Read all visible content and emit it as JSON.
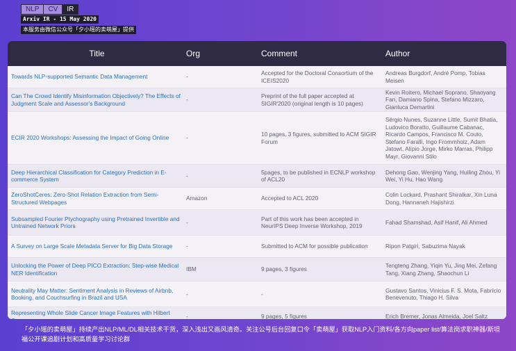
{
  "tabs": [
    {
      "label": "NLP",
      "active": false
    },
    {
      "label": "CV",
      "active": false
    },
    {
      "label": "IR",
      "active": true
    }
  ],
  "header": {
    "date_label": "Arxiv IR - 15 May 2020",
    "credit_label": "本服务由微信公众号「夕小瑶的卖萌屋」提供"
  },
  "table": {
    "columns": [
      "Title",
      "Org",
      "Comment",
      "Author"
    ],
    "rows": [
      {
        "title": "Towards NLP-supported Semantic Data Management",
        "org": "-",
        "comment": "Accepted for the Doctoral Consortium of the ICEIS2020",
        "author": "Andreas Burgdorf, André Pomp, Tobias Meisen"
      },
      {
        "title": "Can The Crowd Identify Misinformation Objectively? The Effects of Judgment Scale and Assessor's Background",
        "org": "-",
        "comment": "Preprint of the full paper accepted at SIGIR'2020 (original length is 10 pages)",
        "author": "Kevin Roitero, Michael Soprano, Shaoyang Fan, Damiano Spina, Stefano Mizzaro, Gianluca Demartini"
      },
      {
        "title": "ECIR 2020 Workshops: Assessing the Impact of Going Online",
        "org": "-",
        "comment": "10 pages, 3 figures, submitted to ACM SIGIR Forum",
        "author": "Sérgio Nunes, Suzanne Little, Sumit Bhatia, Ludovico Boratto, Guillaume Cabanac, Ricardo Campos, Francisco M. Couto, Stefano Faralli, Ingo Frommholz, Adam Jatowt, Alípio Jorge, Mirko Marras, Philipp Mayr, Giovanni Stilo"
      },
      {
        "title": "Deep Hierarchical Classification for Category Prediction in E-commerce System",
        "org": "-",
        "comment": "5pages, to be published in ECNLP workshop of ACL20",
        "author": "Dehong Gao, Wenjing Yang, Huiling Zhou, Yi Wei, Yi Hu, Hao Wang"
      },
      {
        "title": "ZeroShotCeres: Zero-Shot Relation Extraction from Semi-Structured Webpages",
        "org": "Amazon",
        "comment": "Accepted to ACL 2020",
        "author": "Colin Lockard, Prashant Shiralkar, Xin Luna Dong, Hannaneh Hajishirzi"
      },
      {
        "title": "Subsampled Fourier Ptychography using Pretrained Invertible and Untrained Network Priors",
        "org": "-",
        "comment": "Part of this work has been accepted in NeurIPS Deep Inverse Workshop, 2019",
        "author": "Fahad Shamshad, Asif Hanif, Ali Ahmed"
      },
      {
        "title": "A Survey on Large Scale Metadata Server for Big Data Storage",
        "org": "-",
        "comment": "Submitted to ACM for possible publication",
        "author": "Ripon Patgiri, Sabuzima Nayak"
      },
      {
        "title": "Unlocking the Power of Deep PICO Extraction: Step-wise Medical NER Identification",
        "org": "IBM",
        "comment": "9 pages, 3 figures",
        "author": "Tengteng Zhang, Yiqin Yu, Jing Mei, Zefang Tang, Xiang Zhang, Shaochun Li"
      },
      {
        "title": "Neutrality May Matter: Sentiment Analysis in Reviews of Airbnb, Booking, and Couchsurfing in Brazil and USA",
        "org": "-",
        "comment": "-",
        "author": "Gustavo Santos, Vinicius F. S. Mota, Fabrício Benevenuto, Thiago H. Silva"
      },
      {
        "title": "Representing Whole Slide Cancer Image Features with Hilbert Curves",
        "org": "-",
        "comment": "9 pages, 5 figures",
        "author": "Erich Bremer, Jonas Almeida, Joel Saltz"
      }
    ]
  },
  "footer": {
    "text": "「夕小瑶的卖萌屋」持续产出NLP/ML/DL相关技术干货，深入浅出又画风清奇。关注公号后台回复口令「卖萌屋」获取NLP入门资料/各方向paper list/算法岗求职神器/斯坦福公开课追剧计划和高质量学习讨论群"
  },
  "colors": {
    "background_start": "#5b3fd0",
    "background_end": "#8f46c9",
    "table_header": "#302b44",
    "title_link": "#2a6fc2",
    "active_tab": "#252231"
  }
}
